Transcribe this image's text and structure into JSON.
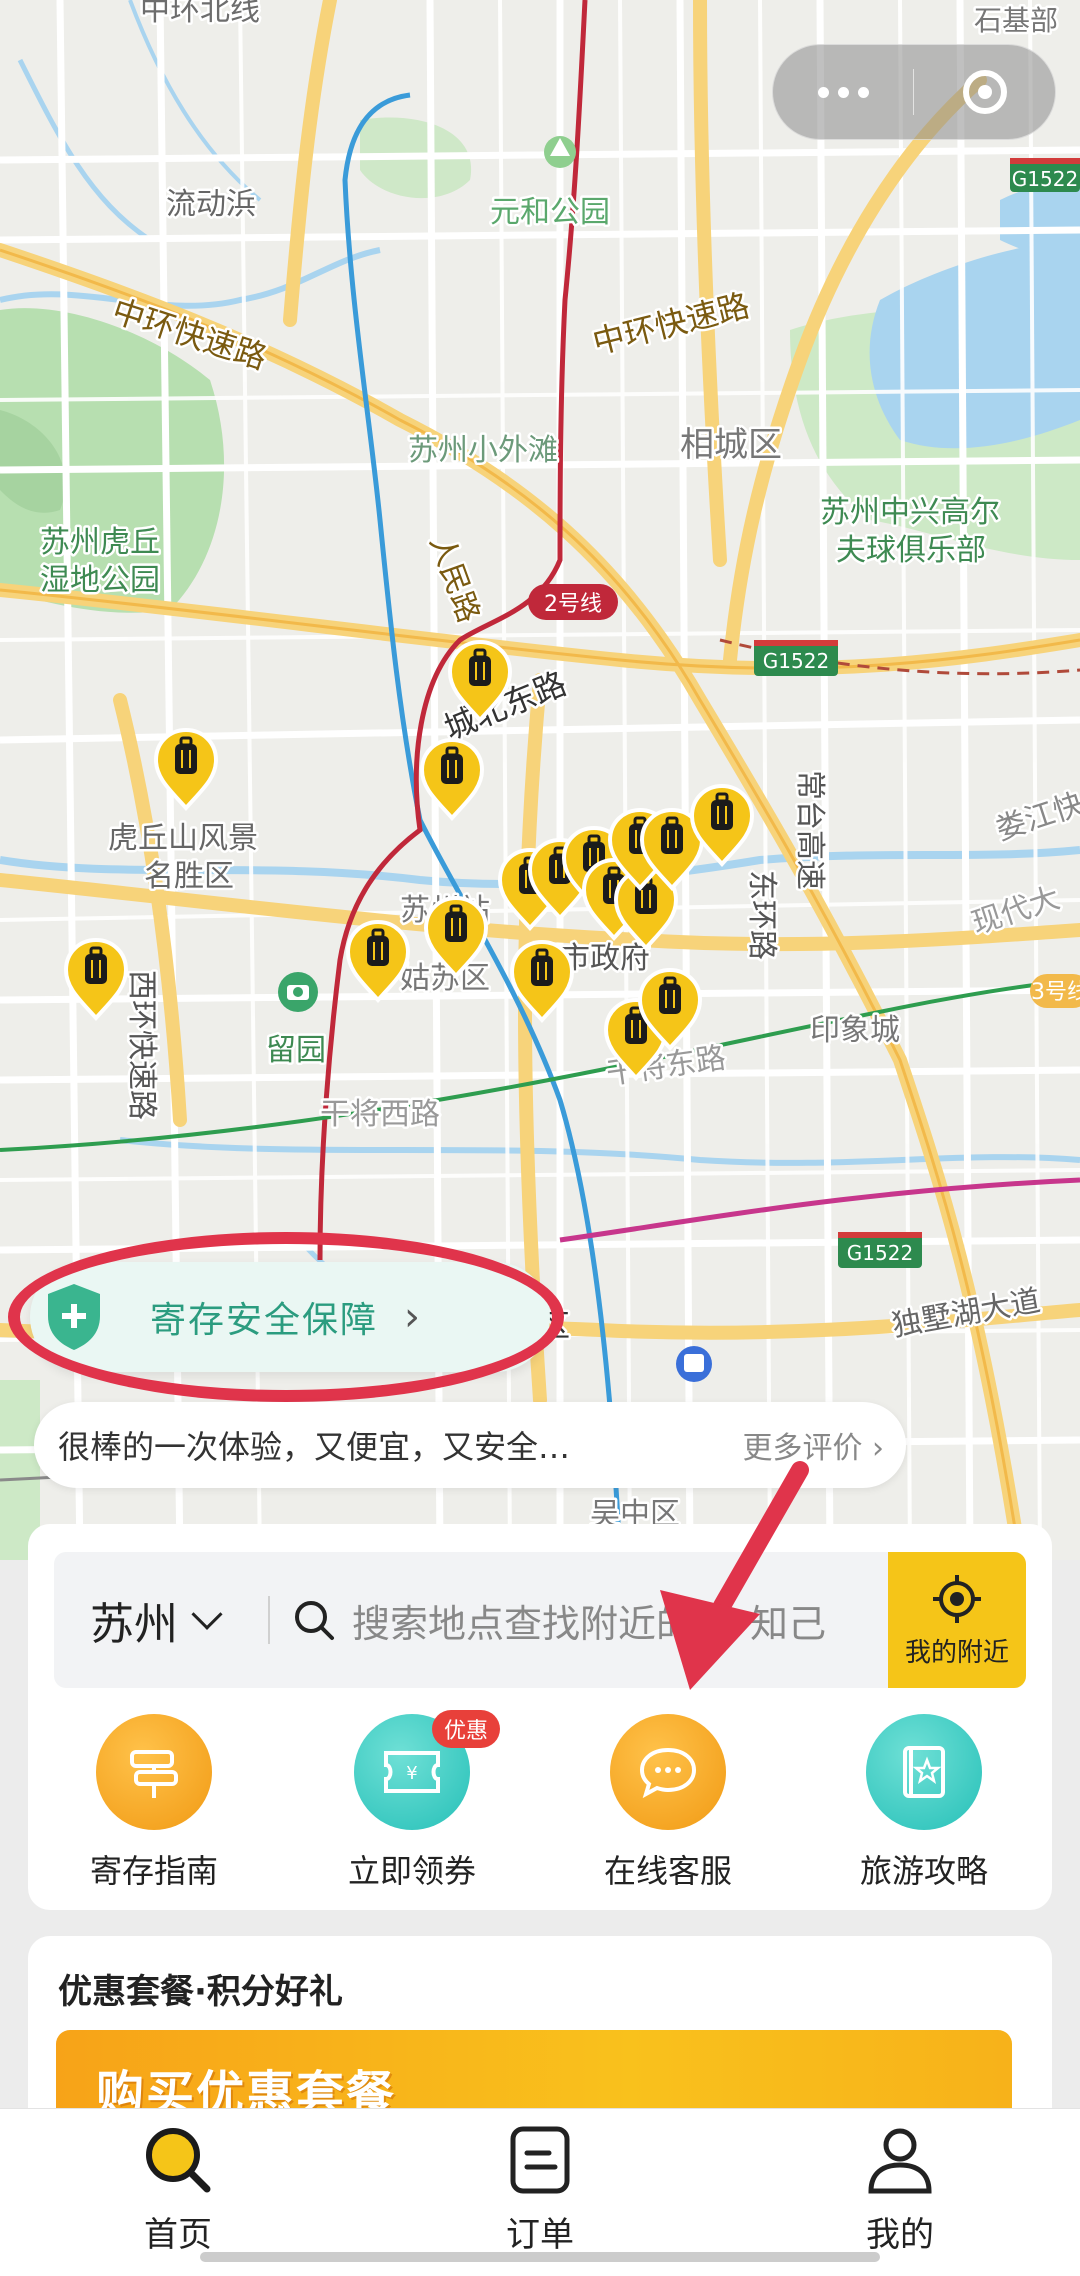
{
  "map": {
    "labels": {
      "zhonghuan_beilu": "中环北线",
      "shijiadu": "石基部",
      "liudongbang": "流动浜",
      "yuanhe_park": "元和公园",
      "zhonghuan_expressway_w": "中环快速路",
      "zhonghuan_expressway_e": "中环快速路",
      "g1522": "G1522",
      "suzhou_bund": "苏州小外滩",
      "xiangcheng": "相城区",
      "huqiu_wetland": "苏州虎丘\n湿地公园",
      "zhongxing_golf": "苏州中兴高尔\n夫球俱乐部",
      "renmin_road": "人民路",
      "line2": "2号线",
      "chengbei_east": "城北东路",
      "huqiu_scenic": "虎丘山风景\n名胜区",
      "changtai_highway": "常台高速",
      "east_ring": "东环路",
      "west_ring": "西环快速路",
      "liuyuan": "留园",
      "suzhou_station": "苏州站",
      "gusu": "姑苏区",
      "city_hall": "市政府",
      "ganjiang_west": "干将西路",
      "ganjiang_east": "干将东路",
      "yinjiacheng": "印象城",
      "panmen": "盘门景区",
      "dushu_lake": "独墅湖大道",
      "wuzhong": "吴中区",
      "line3": "3号线",
      "loujiang": "娄江快",
      "xiandai": "现代大"
    }
  },
  "capsule": {
    "menu_icon": "more-dots-icon",
    "close_icon": "target-icon"
  },
  "guarantee": {
    "label": "寄存安全保障",
    "icon": "shield-plus-icon"
  },
  "review": {
    "text": "很棒的一次体验，又便宜，又安全…",
    "more": "更多评价 ›"
  },
  "search": {
    "city": "苏州",
    "placeholder": "搜索地点查找附近的寄存 知己",
    "value": "搜索地点查找附近的",
    "value_tail": "知己",
    "nearby": "我的附近"
  },
  "quick": [
    {
      "label": "寄存指南",
      "icon": "signpost-icon",
      "color": "#f6a21a"
    },
    {
      "label": "立即领券",
      "icon": "coupon-icon",
      "color": "#3fcfc6",
      "badge": "优惠"
    },
    {
      "label": "在线客服",
      "icon": "chat-icon",
      "color": "#f6a21a"
    },
    {
      "label": "旅游攻略",
      "icon": "guidebook-icon",
      "color": "#3fcfc6"
    }
  ],
  "promo": {
    "title": "优惠套餐·积分好礼",
    "banner": "购买优惠套餐"
  },
  "tabs": [
    {
      "label": "首页",
      "icon": "search-icon",
      "active": true
    },
    {
      "label": "订单",
      "icon": "order-icon",
      "active": false
    },
    {
      "label": "我的",
      "icon": "profile-icon",
      "active": false
    }
  ],
  "colors": {
    "accent": "#f5c518",
    "annotation": "#e0344b",
    "teal": "#2b9c7f"
  }
}
